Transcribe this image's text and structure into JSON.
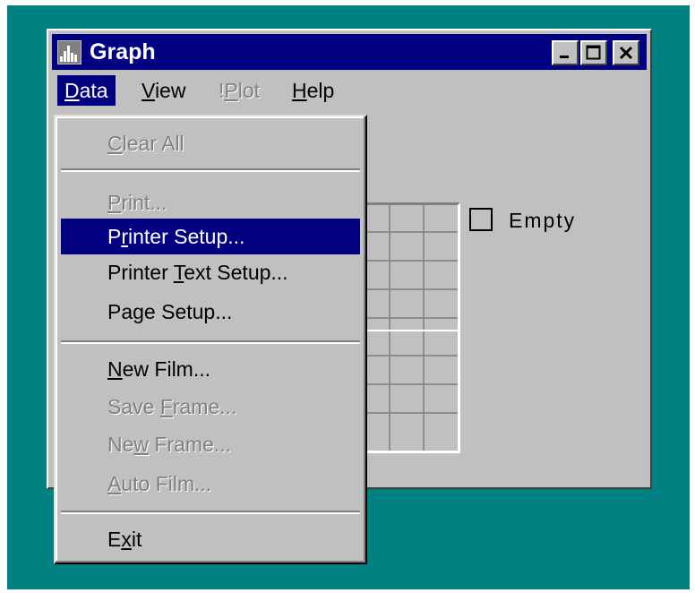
{
  "window": {
    "title": "Graph",
    "controls": {
      "minimize": "minimize-icon",
      "maximize": "maximize-icon",
      "close": "close-icon"
    },
    "app_icon": "graph-app-icon"
  },
  "menubar": {
    "data": {
      "prefix": "",
      "mnemonic": "D",
      "rest": "ata"
    },
    "view": {
      "prefix": "",
      "mnemonic": "V",
      "rest": "iew"
    },
    "plot": {
      "prefix": "!",
      "mnemonic": "P",
      "rest": "lot"
    },
    "help": {
      "prefix": "",
      "mnemonic": "H",
      "rest": "elp"
    }
  },
  "data_menu": {
    "clear_all": {
      "prefix": "",
      "mnemonic": "C",
      "rest": "lear All"
    },
    "print": {
      "prefix": "",
      "mnemonic": "P",
      "rest": "rint..."
    },
    "printer_setup": {
      "prefix": "P",
      "mnemonic": "r",
      "rest": "inter Setup..."
    },
    "printer_text_setup": {
      "prefix": "Printer ",
      "mnemonic": "T",
      "rest": "ext Setup..."
    },
    "page_setup": {
      "prefix": "Page Setup...",
      "mnemonic": "",
      "rest": ""
    },
    "new_film": {
      "prefix": "",
      "mnemonic": "N",
      "rest": "ew Film..."
    },
    "save_frame": {
      "prefix": "Save ",
      "mnemonic": "F",
      "rest": "rame..."
    },
    "new_frame": {
      "prefix": "Ne",
      "mnemonic": "w",
      "rest": " Frame..."
    },
    "auto_film": {
      "prefix": "",
      "mnemonic": "A",
      "rest": "uto Film..."
    },
    "exit": {
      "prefix": "E",
      "mnemonic": "x",
      "rest": "it"
    }
  },
  "panel": {
    "empty_checkbox": {
      "label": "Empty",
      "checked": false
    }
  },
  "colors": {
    "desktop": "#008080",
    "titlebar": "#000080",
    "face": "#c0c0c0",
    "highlight": "#000080",
    "disabled_text": "#808080"
  }
}
